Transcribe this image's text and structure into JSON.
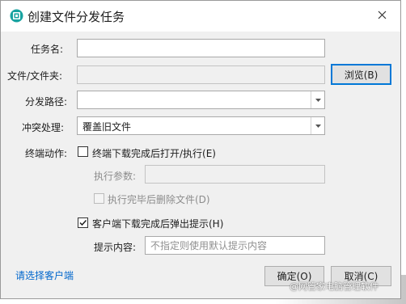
{
  "dialog": {
    "title": "创建文件分发任务",
    "close_glyph": "✕"
  },
  "form": {
    "task_name": {
      "label": "任务名:",
      "value": ""
    },
    "file_folder": {
      "label": "文件/文件夹:",
      "value": "",
      "browse_label": "浏览(B)"
    },
    "dist_path": {
      "label": "分发路径:",
      "value": ""
    },
    "conflict": {
      "label": "冲突处理:",
      "value": "覆盖旧文件"
    },
    "terminal_action": {
      "label": "终端动作:",
      "open_after_download": {
        "label": "终端下载完成后打开/执行(E)",
        "checked": false
      },
      "exec_params": {
        "label": "执行参数:",
        "value": ""
      },
      "delete_after_exec": {
        "label": "执行完毕后删除文件(D)",
        "checked": false
      }
    },
    "popup_notice": {
      "label": "客户端下载完成后弹出提示(H)",
      "checked": true
    },
    "notice_content": {
      "label": "提示内容:",
      "placeholder": "不指定则使用默认提示内容"
    }
  },
  "footer": {
    "select_clients_link": "请选择客户端",
    "ok_label": "确定(O)",
    "cancel_label": "取消(C)"
  },
  "watermark": "@网管家电脑管理软件",
  "colors": {
    "accent": "#0078d7",
    "link": "#0066cc",
    "title_icon": "#17a2a0"
  }
}
